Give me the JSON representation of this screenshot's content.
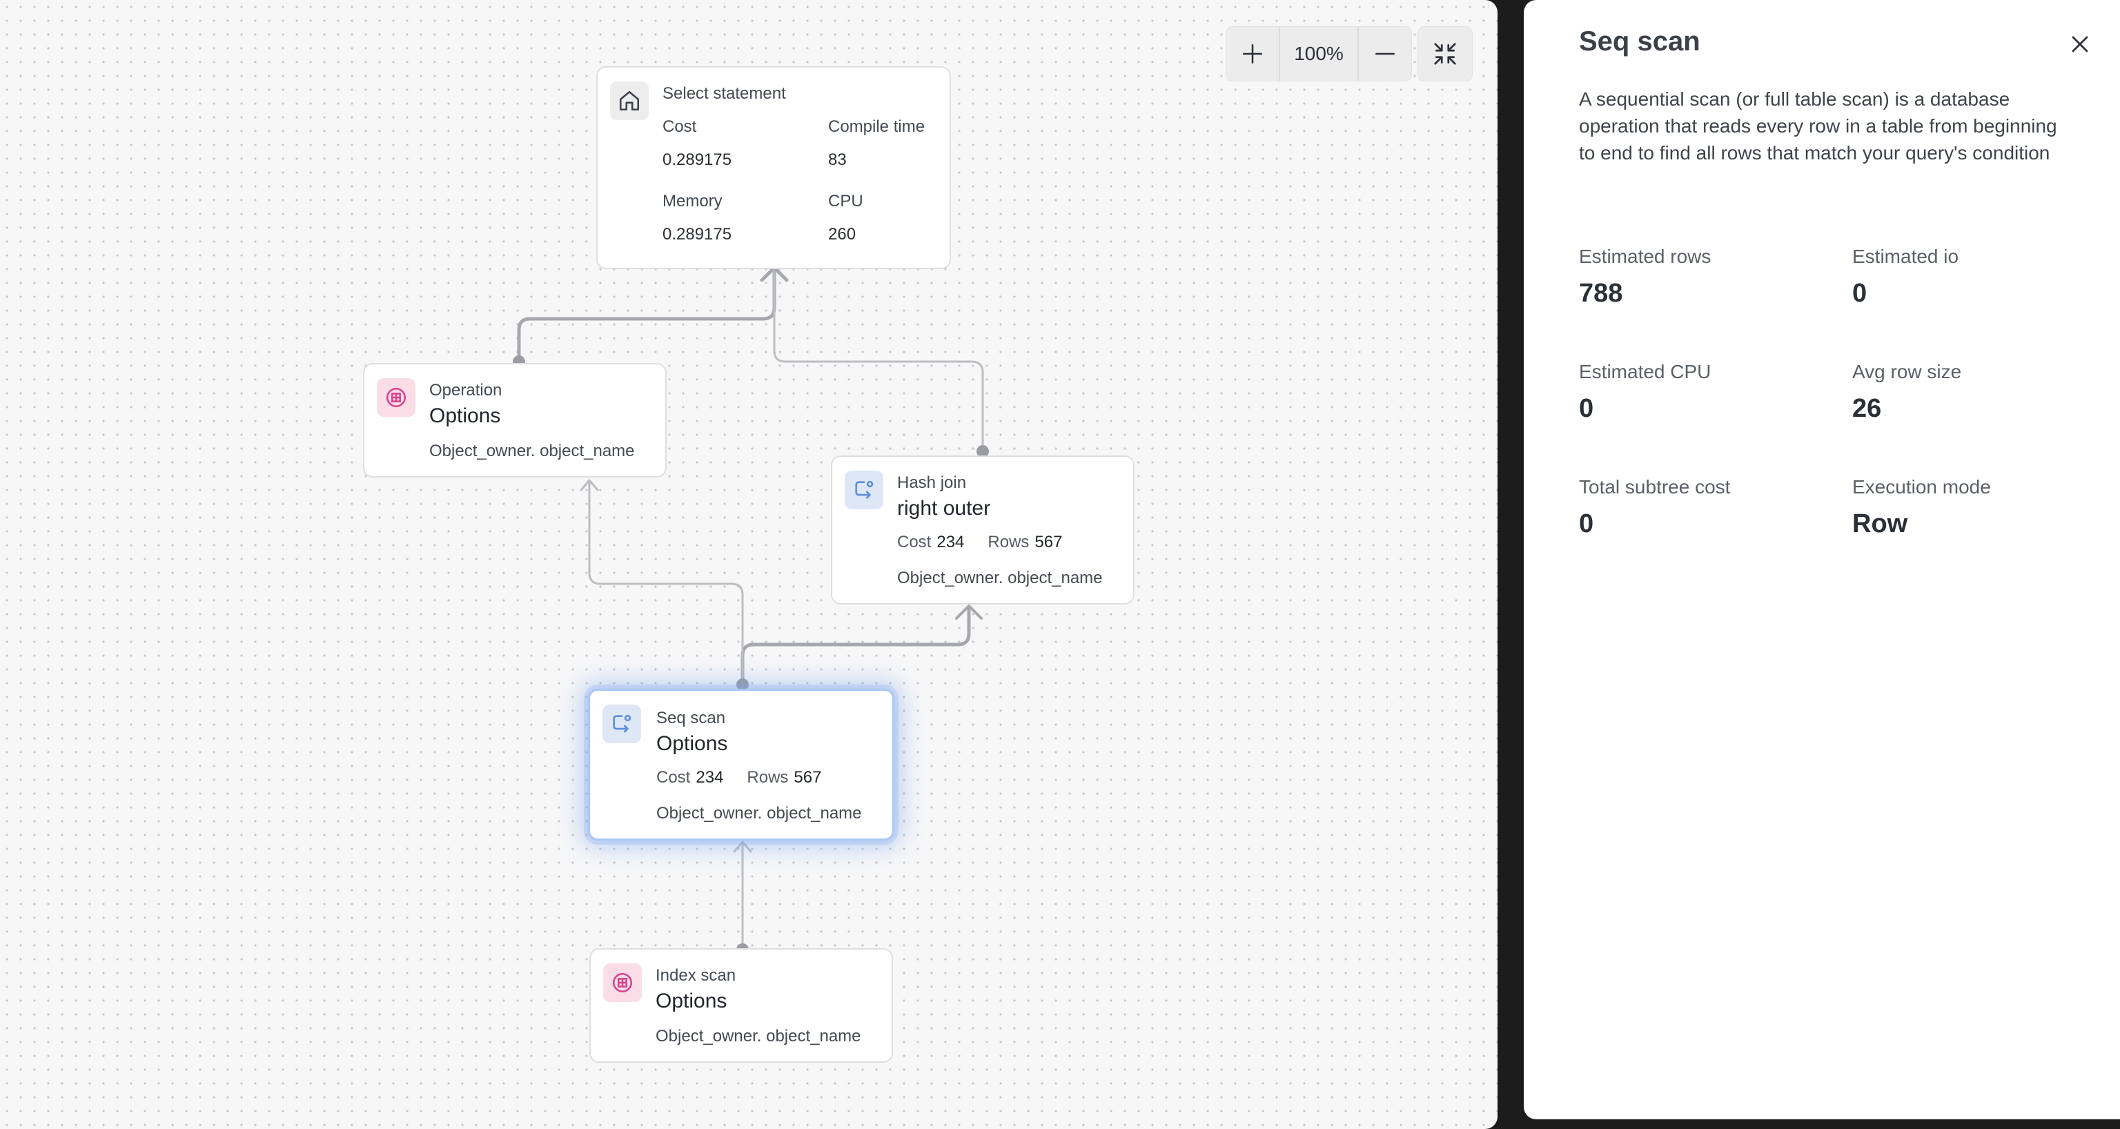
{
  "toolbar": {
    "zoom_level": "100%"
  },
  "nodes": {
    "select": {
      "title": "Select statement",
      "cost_label": "Cost",
      "cost_value": "0.289175",
      "compile_label": "Compile time",
      "compile_value": "83",
      "memory_label": "Memory",
      "memory_value": "0.289175",
      "cpu_label": "CPU",
      "cpu_value": "260",
      "icon": "home-icon"
    },
    "operation": {
      "label": "Operation",
      "title": "Options",
      "object": "Object_owner. object_name",
      "icon": "table-icon"
    },
    "hash_join": {
      "label": "Hash join",
      "title": "right outer",
      "cost_label": "Cost",
      "cost_value": "234",
      "rows_label": "Rows",
      "rows_value": "567",
      "object": "Object_owner. object_name",
      "icon": "scan-icon"
    },
    "seq_scan": {
      "label": "Seq scan",
      "title": "Options",
      "cost_label": "Cost",
      "cost_value": "234",
      "rows_label": "Rows",
      "rows_value": "567",
      "object": "Object_owner. object_name",
      "icon": "scan-icon"
    },
    "index_scan": {
      "label": "Index scan",
      "title": "Options",
      "object": "Object_owner. object_name",
      "icon": "table-icon"
    }
  },
  "panel": {
    "title": "Seq scan",
    "description": "A sequential scan (or full table scan) is a database operation that reads every row in a table from beginning to end to find all rows that match your query's condition",
    "metrics": [
      {
        "label": "Estimated rows",
        "value": "788"
      },
      {
        "label": "Estimated io",
        "value": "0"
      },
      {
        "label": "Estimated CPU",
        "value": "0"
      },
      {
        "label": "Avg row size",
        "value": "26"
      },
      {
        "label": "Total subtree cost",
        "value": "0"
      },
      {
        "label": "Execution mode",
        "value": "Row"
      }
    ]
  },
  "colors": {
    "accent_blue": "#5b8fd9",
    "pink_icon": "#d9428c",
    "edge": "#a6a8ad",
    "edge_light": "#bcbec2"
  }
}
